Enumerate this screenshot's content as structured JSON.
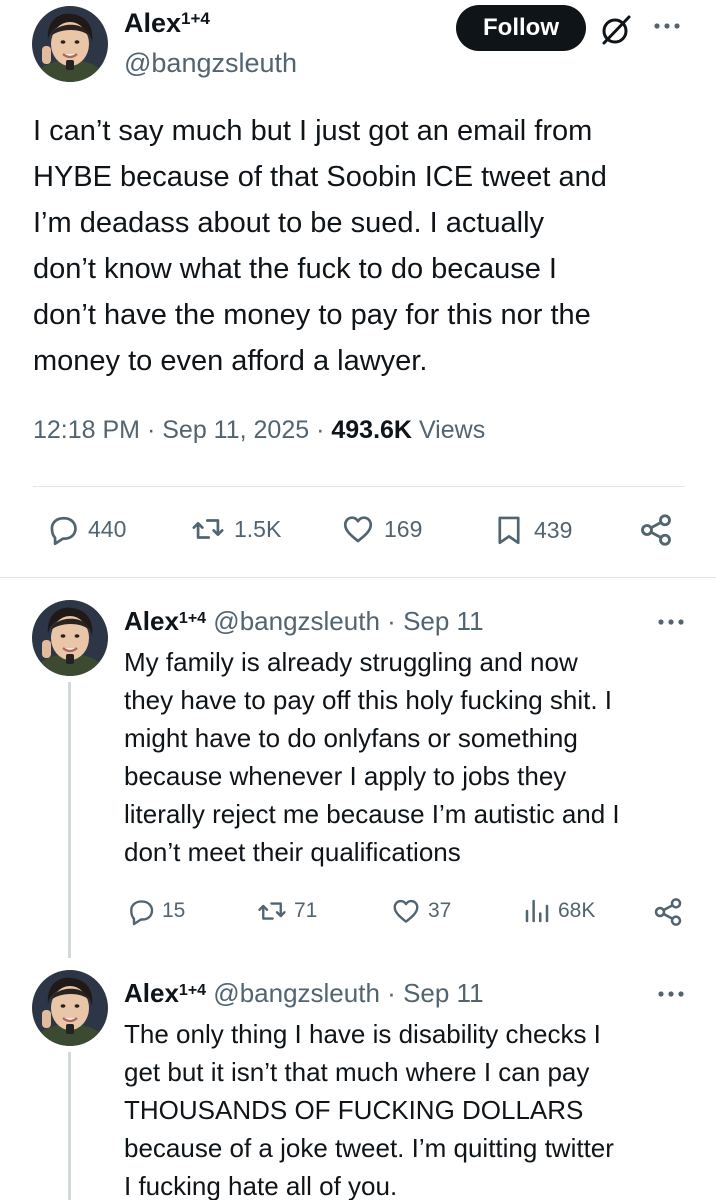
{
  "main_tweet": {
    "display_name": "Alex",
    "name_superscript": "1+4",
    "handle": "@bangzsleuth",
    "follow_label": "Follow",
    "text": "I can’t say much but I just got an email from\nHYBE because of that Soobin ICE tweet and\nI’m deadass about to be sued. I actually\ndon’t know what the fuck to do because I\ndon’t have the money to pay for this nor the\nmoney to even afford a lawyer.",
    "time": "12:18 PM",
    "date": "Sep 11, 2025",
    "views_count": "493.6K",
    "views_label": "Views",
    "separator": "·",
    "actions": {
      "replies": "440",
      "retweets": "1.5K",
      "likes": "169",
      "bookmarks": "439"
    }
  },
  "replies": [
    {
      "display_name": "Alex",
      "name_superscript": "1+4",
      "handle": "@bangzsleuth",
      "separator": "·",
      "date": "Sep 11",
      "text": "My family is already struggling and now\nthey have to pay off this holy fucking shit. I\nmight have to do onlyfans or something\nbecause whenever I apply to jobs they\nliterally reject me because I’m autistic and I\ndon’t meet their qualifications",
      "actions": {
        "replies": "15",
        "retweets": "71",
        "likes": "37",
        "views": "68K"
      }
    },
    {
      "display_name": "Alex",
      "name_superscript": "1+4",
      "handle": "@bangzsleuth",
      "separator": "·",
      "date": "Sep 11",
      "text": "The only thing I have is disability checks I\nget but it isn’t that much where I can pay\nTHOUSANDS OF FUCKING DOLLARS\nbecause of a joke tweet. I’m quitting twitter\nI fucking hate all of you."
    }
  ],
  "icons": {
    "reply": "reply-icon",
    "retweet": "retweet-icon",
    "like": "heart-icon",
    "bookmark": "bookmark-icon",
    "share": "share-icon",
    "views": "views-icon",
    "grok": "grok-icon",
    "more": "more-icon"
  },
  "colors": {
    "text": "#0f1419",
    "secondary": "#536471",
    "follow_bg": "#0f1419",
    "divider": "#e1e6ea",
    "thread_line": "#cfd9de"
  }
}
